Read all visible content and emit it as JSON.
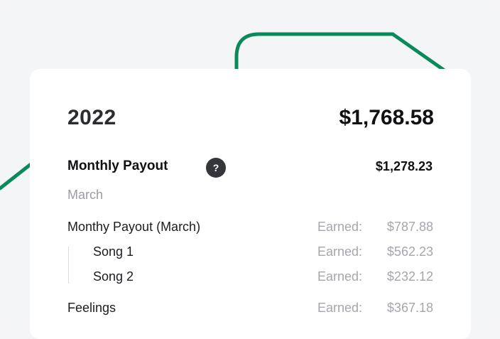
{
  "summary": {
    "year": "2022",
    "total": "$1,768.58"
  },
  "monthly": {
    "label": "Monthly Payout",
    "help_icon": "?",
    "amount": "$1,278.23",
    "month": "March"
  },
  "rows": [
    {
      "name": "Monthy Payout (March)",
      "earned_label": "Earned:",
      "amount": "$787.88"
    },
    {
      "name": "Song 1",
      "earned_label": "Earned:",
      "amount": "$562.23"
    },
    {
      "name": "Song 2",
      "earned_label": "Earned:",
      "amount": "$232.12"
    },
    {
      "name": "Feelings",
      "earned_label": "Earned:",
      "amount": "$367.18"
    }
  ],
  "colors": {
    "accent_line": "#0a8a5b",
    "card": "#ffffff",
    "background": "#f4f5f7"
  }
}
